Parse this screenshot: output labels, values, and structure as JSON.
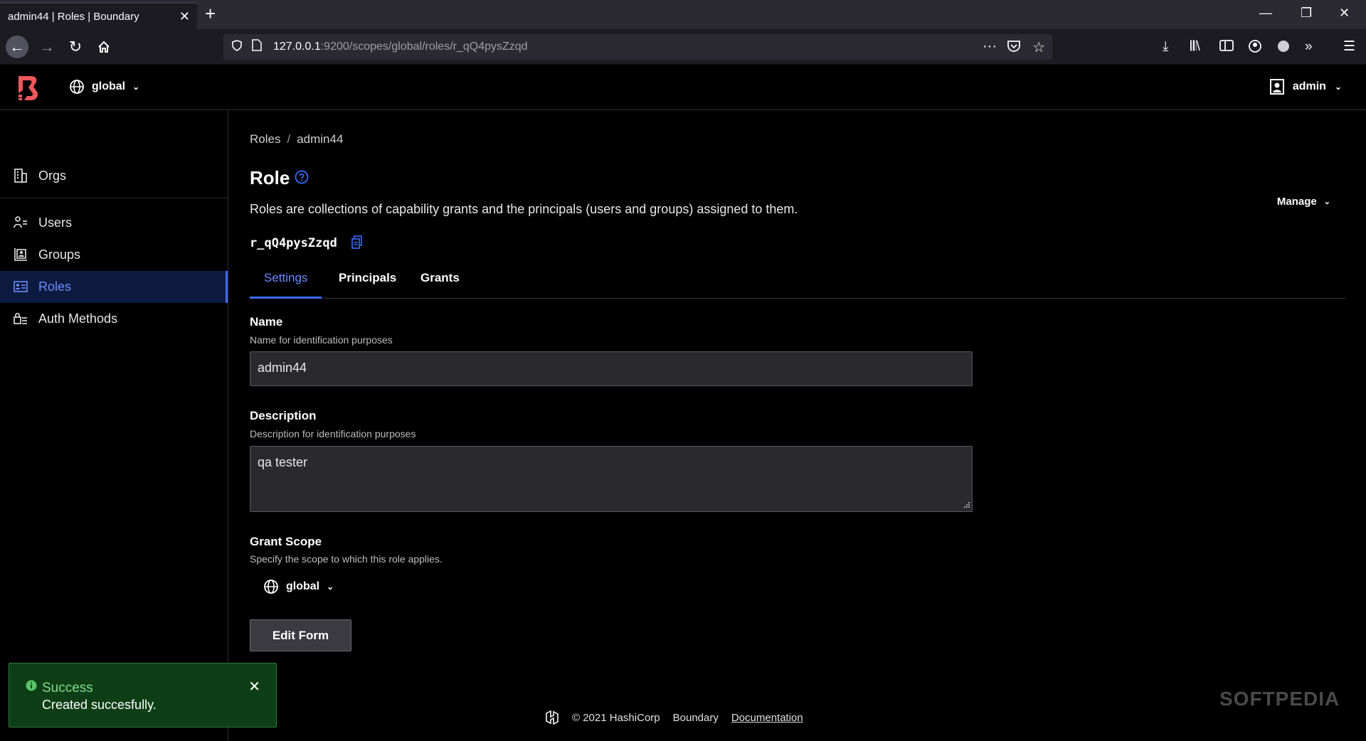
{
  "browser": {
    "tab_title": "admin44 | Roles | Boundary",
    "url_host": "127.0.0.1",
    "url_path": ":9200/scopes/global/roles/r_qQ4pysZzqd"
  },
  "header": {
    "scope_label": "global",
    "user_label": "admin"
  },
  "sidebar": {
    "items": [
      {
        "label": "Orgs",
        "icon": "org-icon"
      },
      {
        "label": "Users",
        "icon": "users-icon"
      },
      {
        "label": "Groups",
        "icon": "groups-icon"
      },
      {
        "label": "Roles",
        "icon": "roles-icon",
        "active": true
      },
      {
        "label": "Auth Methods",
        "icon": "auth-methods-icon"
      }
    ]
  },
  "main": {
    "breadcrumb": [
      "Roles",
      "admin44"
    ],
    "title": "Role",
    "description": "Roles are collections of capability grants and the principals (users and groups) assigned to them.",
    "manage_label": "Manage",
    "role_id": "r_qQ4pysZzqd",
    "tabs": [
      {
        "label": "Settings",
        "active": true
      },
      {
        "label": "Principals"
      },
      {
        "label": "Grants"
      }
    ],
    "form": {
      "name": {
        "label": "Name",
        "help": "Name for identification purposes",
        "value": "admin44"
      },
      "description": {
        "label": "Description",
        "help": "Description for identification purposes",
        "value": "qa tester"
      },
      "grant_scope": {
        "label": "Grant Scope",
        "help": "Specify the scope to which this role applies.",
        "value": "global"
      },
      "edit_button": "Edit Form"
    }
  },
  "footer": {
    "copyright": "© 2021 HashiCorp",
    "product": "Boundary",
    "docs_link": "Documentation"
  },
  "toast": {
    "title": "Success",
    "message": "Created succesfully."
  },
  "watermark": "SOFTPEDIA",
  "colors": {
    "accent": "#3b6cff",
    "brand_red": "#ec585d",
    "success_bg": "#0e3e16"
  }
}
